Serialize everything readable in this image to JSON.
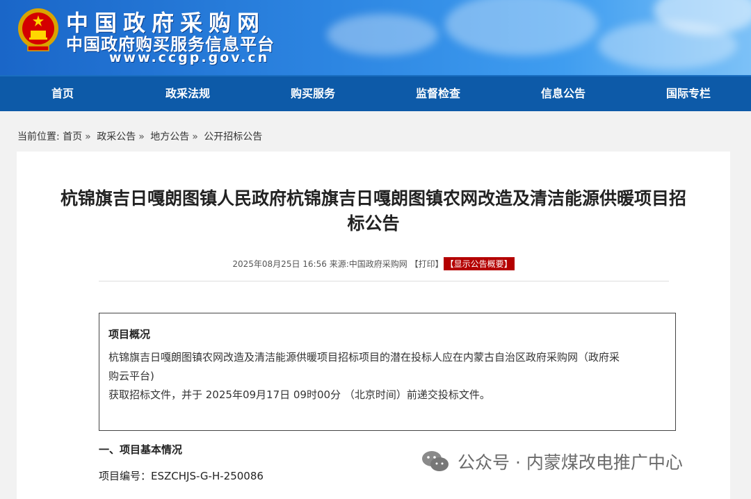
{
  "header": {
    "site_name": "中国政府采购网",
    "site_subtitle": "中国政府购买服务信息平台",
    "site_url": "www.ccgp.gov.cn",
    "brand_color": "#1a66c8"
  },
  "nav": {
    "items": [
      {
        "label": "首页"
      },
      {
        "label": "政采法规"
      },
      {
        "label": "购买服务"
      },
      {
        "label": "监督检查"
      },
      {
        "label": "信息公告"
      },
      {
        "label": "国际专栏"
      }
    ]
  },
  "breadcrumb": {
    "prefix": "当前位置:",
    "items": [
      "首页",
      "政采公告",
      "地方公告",
      "公开招标公告"
    ],
    "separator": "»"
  },
  "article": {
    "title_line1": "杭锦旗吉日嘎朗图镇人民政府杭锦旗吉日嘎朗图镇农网改造及清洁能源供暖项目招",
    "title_line2": "标公告",
    "datetime": "2025年08月25日 16:56",
    "source_label": "来源:",
    "source": "中国政府采购网",
    "print_link": "【打印】",
    "show_summary": "【显示公告概要】",
    "summary_title": "项目概况",
    "summary_line1": "杭锦旗吉日嘎朗图镇农网改造及清洁能源供暖项目招标项目的潜在投标人应在内蒙古自治区政府采购网（政府采",
    "summary_line2": "购云平台)",
    "summary_line3": "获取招标文件，并于 2025年09月17日 09时00分 （北京时间）前递交投标文件。",
    "section1_title": "一、项目基本情况",
    "project_no": "项目编号：ESZCHJS-G-H-250086"
  },
  "watermark": {
    "text": "公众号 · 内蒙煤改电推广中心",
    "icon": "wechat-icon"
  }
}
